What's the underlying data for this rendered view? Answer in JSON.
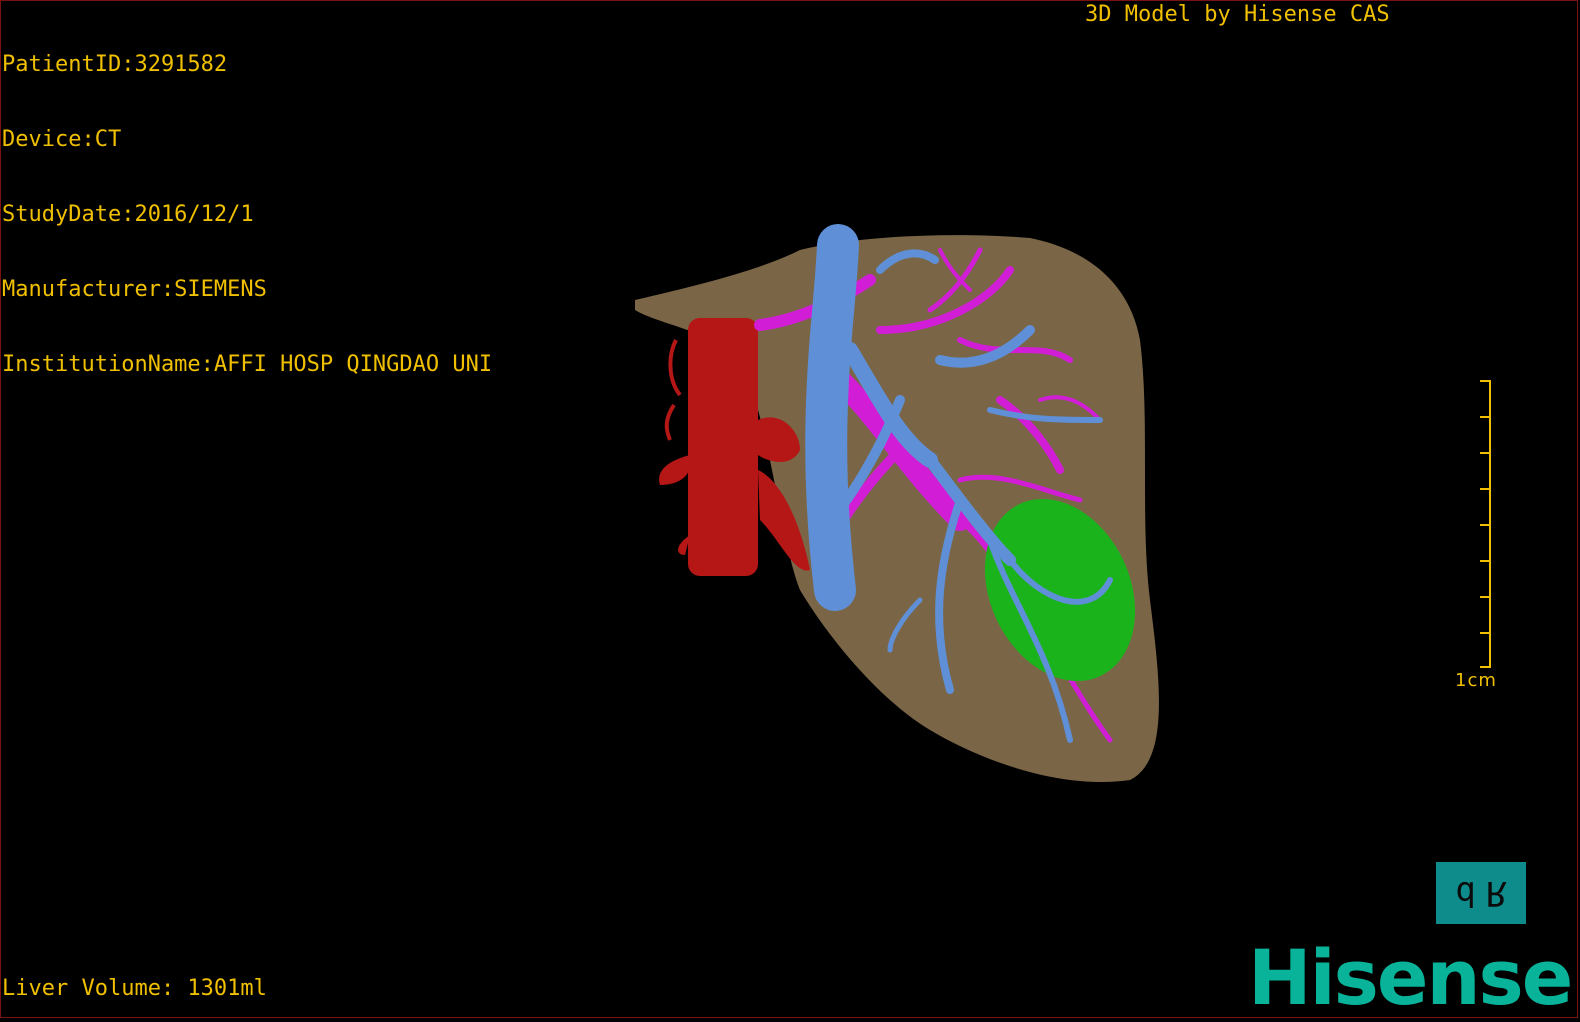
{
  "overlay": {
    "patient_id": "PatientID:3291582",
    "device": "Device:CT",
    "study_date": "StudyDate:2016/12/1",
    "manufacturer": "Manufacturer:SIEMENS",
    "institution": "InstitutionName:AFFI HOSP QINGDAO UNI",
    "credit": "3D Model by Hisense CAS",
    "liver_volume": "Liver Volume: 1301ml"
  },
  "scale_bar": {
    "label": "1cm"
  },
  "orientation_button": {
    "left": "d",
    "right": "R"
  },
  "brand": {
    "logo_text": "Hisense"
  },
  "colors": {
    "overlay_text": "#f0c000",
    "liver": "#7a6647",
    "artery": "#b51616",
    "portal_vein": "#d11ed6",
    "hepatic_vein": "#5f8fd6",
    "tumor": "#1bb31b",
    "brand": "#08b39a"
  }
}
